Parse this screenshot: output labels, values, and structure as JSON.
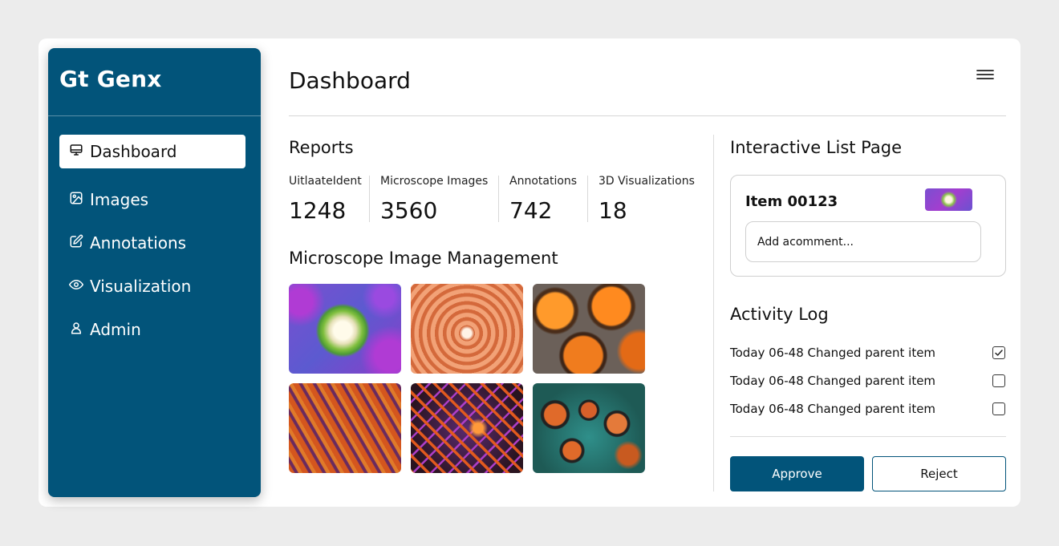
{
  "sidebar": {
    "brand": "Gt Genx",
    "items": [
      {
        "label": "Dashboard",
        "icon": "monitor-icon",
        "active": true
      },
      {
        "label": "Images",
        "icon": "image-icon",
        "active": false
      },
      {
        "label": "Annotations",
        "icon": "edit-icon",
        "active": false
      },
      {
        "label": "Visualization",
        "icon": "eye-icon",
        "active": false
      },
      {
        "label": "Admin",
        "icon": "user-icon",
        "active": false
      }
    ]
  },
  "header": {
    "title": "Dashboard",
    "menu_icon": "hamburger-menu-icon"
  },
  "reports": {
    "title": "Reports",
    "stats": [
      {
        "label": "UitlaateIdent",
        "value": "1248"
      },
      {
        "label": "Microscope Images",
        "value": "3560"
      },
      {
        "label": "Annotations",
        "value": "742"
      },
      {
        "label": "3D Visualizations",
        "value": "18"
      }
    ]
  },
  "gallery": {
    "title": "Microscope Image Management"
  },
  "list_page": {
    "title": "Interactive List Page",
    "item_title": "Item 00123",
    "comment_placeholder": "Add acomment..."
  },
  "activity": {
    "title": "Activity Log",
    "entries": [
      {
        "text": "Today 06-48 Changed parent item",
        "checked": true
      },
      {
        "text": "Today 06-48 Changed parent item",
        "checked": false
      },
      {
        "text": "Today 06-48 Changed parent item",
        "checked": false
      }
    ]
  },
  "actions": {
    "approve_label": "Approve",
    "reject_label": "Reject"
  },
  "colors": {
    "primary": "#02547a",
    "background": "#ececec",
    "card": "#ffffff"
  }
}
